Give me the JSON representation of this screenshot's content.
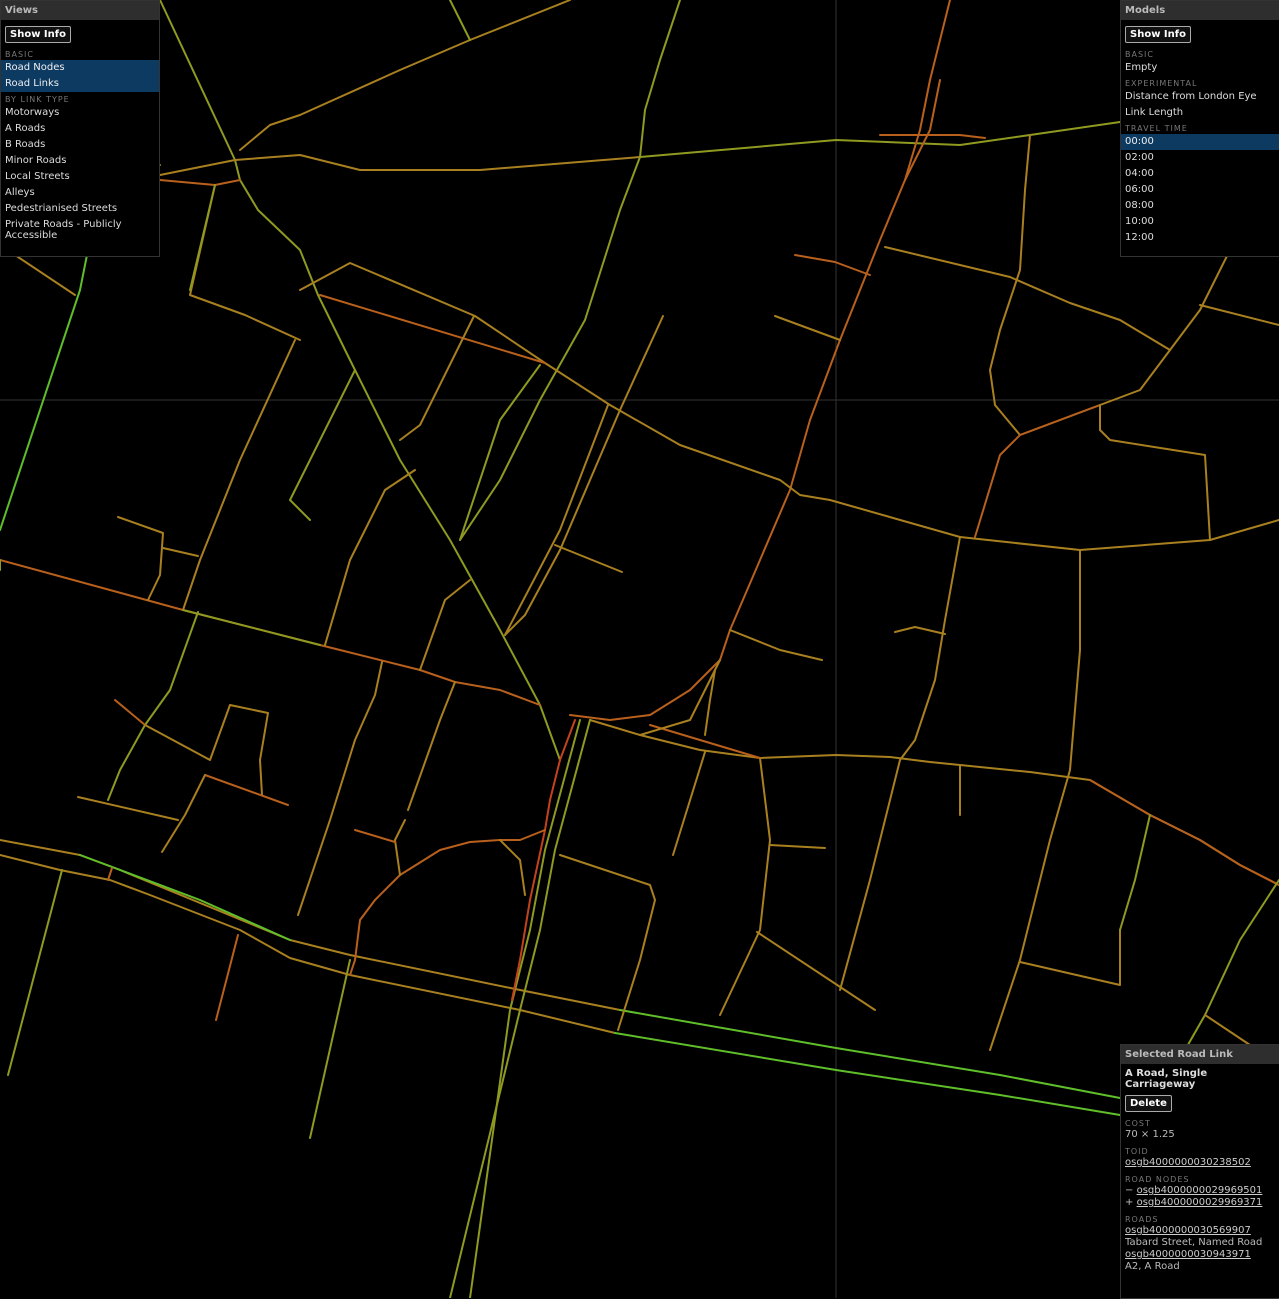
{
  "views": {
    "title": "Views",
    "show_info": "Show Info",
    "basic_label": "BASIC",
    "basic_items": [
      "Road Nodes",
      "Road Links"
    ],
    "link_type_label": "BY LINK TYPE",
    "link_types": [
      "Motorways",
      "A Roads",
      "B Roads",
      "Minor Roads",
      "Local Streets",
      "Alleys",
      "Pedestrianised Streets",
      "Private Roads - Publicly Accessible"
    ]
  },
  "models": {
    "title": "Models",
    "show_info": "Show Info",
    "basic_label": "BASIC",
    "basic_items": [
      "Empty"
    ],
    "experimental_label": "EXPERIMENTAL",
    "experimental_items": [
      "Distance from London Eye",
      "Link Length"
    ],
    "travel_time_label": "TRAVEL TIME",
    "travel_times": [
      "00:00",
      "02:00",
      "04:00",
      "06:00",
      "08:00",
      "10:00",
      "12:00"
    ]
  },
  "selected": {
    "title": "Selected Road Link",
    "type": "A Road, Single Carriageway",
    "delete": "Delete",
    "cost_label": "COST",
    "cost": "70 × 1.25",
    "toid_label": "TOID",
    "toid": "osgb4000000030238502",
    "nodes_label": "ROAD NODES",
    "node_minus_sign": "−",
    "node_minus": "osgb4000000029969501",
    "node_plus_sign": "+",
    "node_plus": "osgb4000000029969371",
    "roads_label": "ROADS",
    "road1_id": "osgb4000000030569907",
    "road1_name": "Tabard Street, Named Road",
    "road2_id": "osgb4000000030943971",
    "road2_name": "A2, A Road"
  },
  "colors": {
    "green": "#5fbf2a",
    "olive": "#8f9a20",
    "amber": "#a9801f",
    "orange": "#b8601c",
    "red": "#c4421c",
    "selected": "#0d3a61"
  }
}
